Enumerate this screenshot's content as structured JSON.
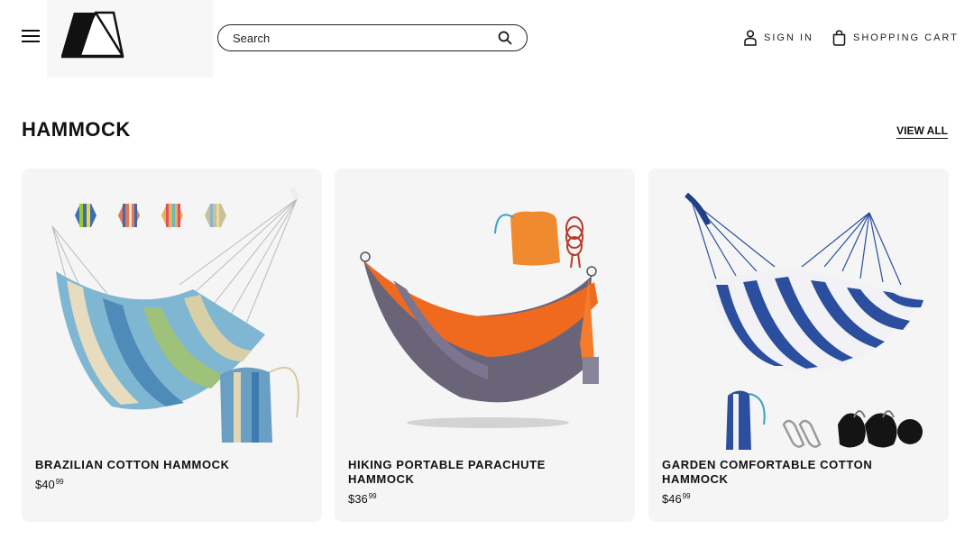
{
  "header": {
    "search": {
      "placeholder": "Search",
      "value": ""
    },
    "sign_in_label": "SIGN IN",
    "cart_label": "SHOPPING CART"
  },
  "section": {
    "title": "HAMMOCK",
    "view_all_label": "VIEW ALL"
  },
  "products": [
    {
      "name": "BRAZILIAN COTTON HAMMOCK",
      "price_main": "$40",
      "price_cents": "99"
    },
    {
      "name": "HIKING PORTABLE PARACHUTE HAMMOCK",
      "price_main": "$36",
      "price_cents": "99"
    },
    {
      "name": "GARDEN COMFORTABLE COTTON HAMMOCK",
      "price_main": "$46",
      "price_cents": "99"
    }
  ],
  "colors": {
    "text": "#111111",
    "card_bg": "#f5f5f5",
    "logo_bg": "#f7f7f7"
  },
  "icons": [
    "menu-icon",
    "logo-tent-icon",
    "search-icon",
    "user-icon",
    "shopping-bag-icon"
  ]
}
